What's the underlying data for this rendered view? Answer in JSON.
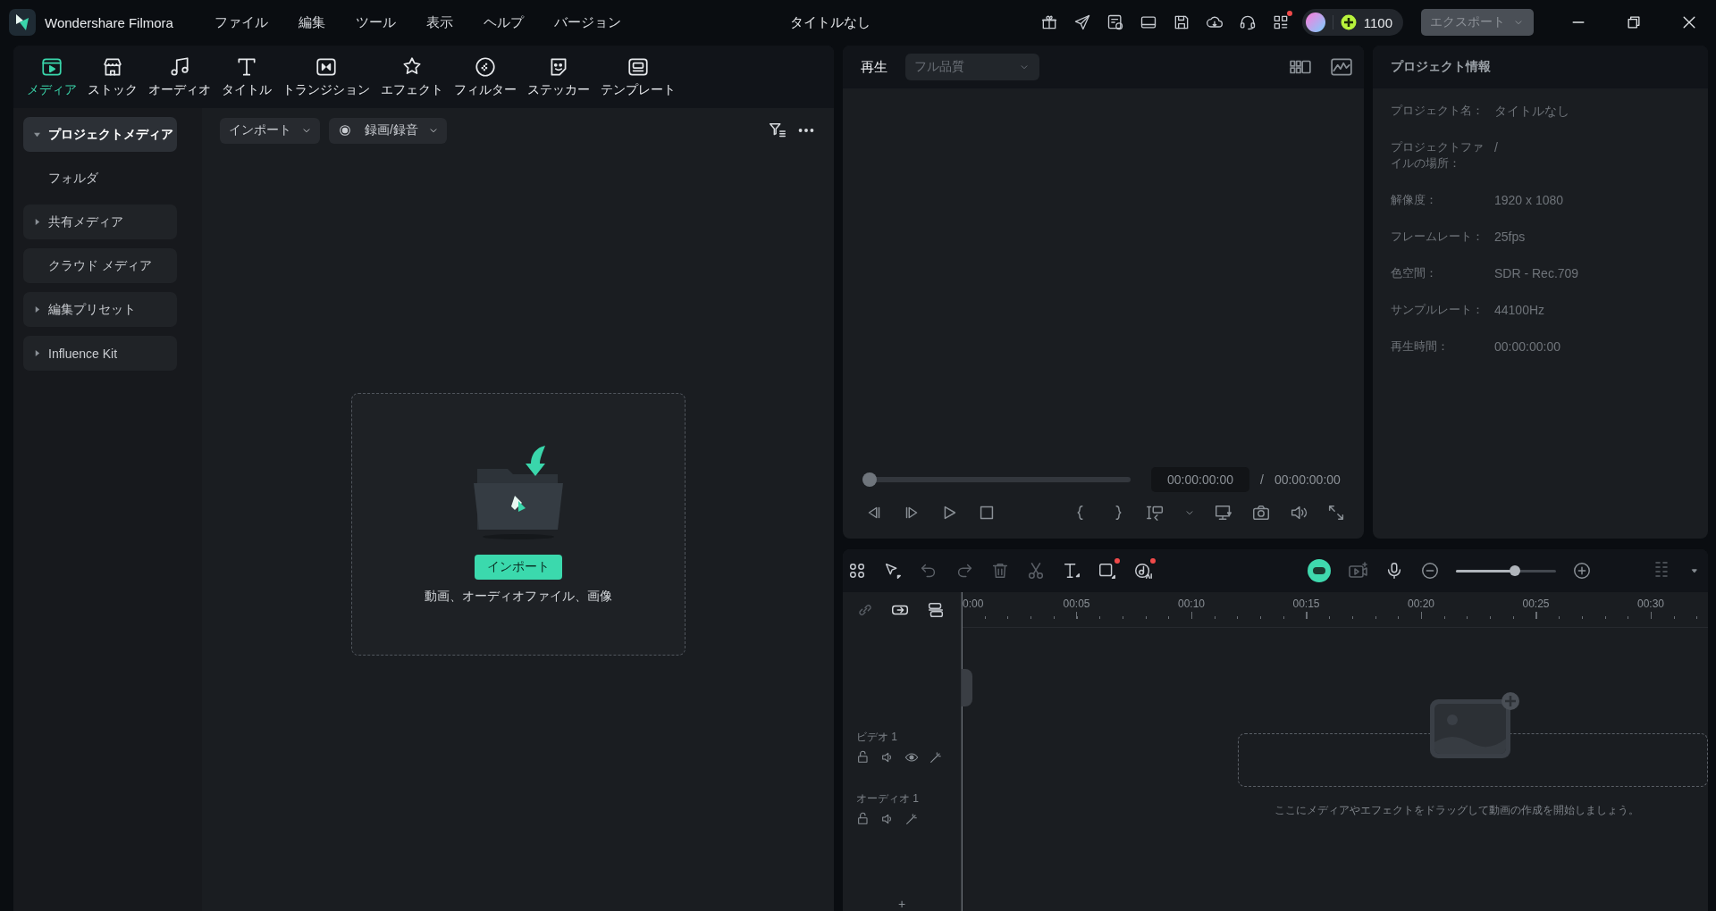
{
  "app": {
    "name": "Wondershare Filmora"
  },
  "menu": [
    "ファイル",
    "編集",
    "ツール",
    "表示",
    "ヘルプ",
    "バージョン"
  ],
  "window": {
    "title": "タイトルなし"
  },
  "account": {
    "credits": "1100"
  },
  "export_button": {
    "label": "エクスポート",
    "disabled": true
  },
  "media_tabs": [
    {
      "label": "メディア",
      "kind": "media",
      "selected": true
    },
    {
      "label": "ストック",
      "kind": "stock",
      "selected": false
    },
    {
      "label": "オーディオ",
      "kind": "audio",
      "selected": false
    },
    {
      "label": "タイトル",
      "kind": "title",
      "selected": false
    },
    {
      "label": "トランジション",
      "kind": "transition",
      "selected": false
    },
    {
      "label": "エフェクト",
      "kind": "effect",
      "selected": false
    },
    {
      "label": "フィルター",
      "kind": "filter",
      "selected": false
    },
    {
      "label": "ステッカー",
      "kind": "sticker",
      "selected": false
    },
    {
      "label": "テンプレート",
      "kind": "template",
      "selected": false
    }
  ],
  "sidebar": {
    "items": [
      {
        "label": "プロジェクトメディア",
        "kind": "group",
        "expanded": true,
        "selected": true,
        "children": [
          {
            "label": "フォルダ",
            "selected": false
          }
        ]
      },
      {
        "label": "共有メディア",
        "kind": "group",
        "expanded": false,
        "selected": false
      },
      {
        "label": "クラウド メディア",
        "kind": "plain",
        "selected": false
      },
      {
        "label": "編集プリセット",
        "kind": "group",
        "expanded": false,
        "selected": false
      },
      {
        "label": "Influence Kit",
        "kind": "group",
        "expanded": false,
        "selected": false
      }
    ]
  },
  "media_toolbar": {
    "import": "インポート",
    "record": "録画/録音"
  },
  "dropzone": {
    "button": "インポート",
    "hint": "動画、オーディオファイル、画像"
  },
  "player": {
    "tab": "再生",
    "quality": {
      "value": "フル品質",
      "disabled": true
    },
    "progress": {
      "level": 0
    },
    "current_time": "00:00:00:00",
    "separator": "/",
    "total_time": "00:00:00:00"
  },
  "project_info": {
    "title": "プロジェクト情報",
    "rows": [
      {
        "label": "プロジェクト名：",
        "value": "タイトルなし"
      },
      {
        "label": "プロジェクトファイルの場所：",
        "value": "/"
      },
      {
        "label": "解像度：",
        "value": "1920 x 1080"
      },
      {
        "label": "フレームレート：",
        "value": "25fps"
      },
      {
        "label": "色空間：",
        "value": "SDR - Rec.709"
      },
      {
        "label": "サンプルレート：",
        "value": "44100Hz"
      },
      {
        "label": "再生時間：",
        "value": "00:00:00:00"
      }
    ]
  },
  "timeline": {
    "zoom": {
      "level": 0.6
    },
    "ruler": [
      "0:00",
      "00:05",
      "00:10",
      "00:15",
      "00:20",
      "00:25",
      "00:30"
    ],
    "tracks": [
      {
        "name": "ビデオ 1",
        "kind": "video"
      },
      {
        "name": "オーディオ 1",
        "kind": "audio"
      }
    ],
    "drop_hint": "ここにメディアやエフェクトをドラッグして動画の作成を開始しましょう。",
    "add_track": "+"
  }
}
